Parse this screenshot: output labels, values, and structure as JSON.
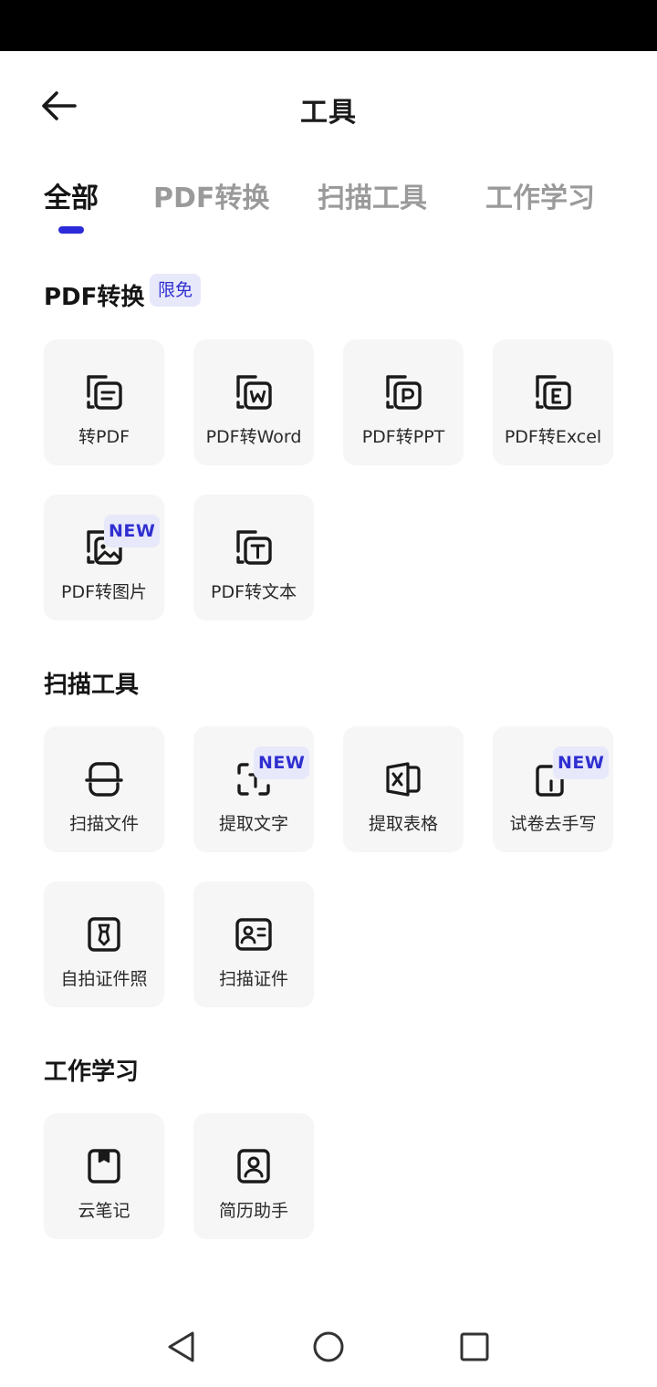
{
  "header": {
    "title": "工具",
    "back_icon": "arrow-left-icon"
  },
  "tabs": [
    {
      "label": "全部",
      "active": true
    },
    {
      "label": "PDF转换",
      "active": false
    },
    {
      "label": "扫描工具",
      "active": false
    },
    {
      "label": "工作学习",
      "active": false
    }
  ],
  "colors": {
    "accent": "#2b2bd9",
    "badge_bg": "#e8e8fb",
    "tile_bg": "#f6f6f6",
    "inactive_tab": "#9a9a9a"
  },
  "sections": [
    {
      "title": "PDF转换",
      "badge": "限免",
      "tools": [
        {
          "label": "转PDF",
          "icon": "convert-to-pdf-icon"
        },
        {
          "label": "PDF转Word",
          "icon": "pdf-to-word-icon"
        },
        {
          "label": "PDF转PPT",
          "icon": "pdf-to-ppt-icon"
        },
        {
          "label": "PDF转Excel",
          "icon": "pdf-to-excel-icon"
        },
        {
          "label": "PDF转图片",
          "icon": "pdf-to-image-icon",
          "badge": "NEW"
        },
        {
          "label": "PDF转文本",
          "icon": "pdf-to-text-icon"
        }
      ]
    },
    {
      "title": "扫描工具",
      "tools": [
        {
          "label": "扫描文件",
          "icon": "scan-document-icon"
        },
        {
          "label": "提取文字",
          "icon": "extract-text-icon",
          "badge": "NEW"
        },
        {
          "label": "提取表格",
          "icon": "extract-table-icon"
        },
        {
          "label": "试卷去手写",
          "icon": "remove-handwriting-icon",
          "badge": "NEW"
        },
        {
          "label": "自拍证件照",
          "icon": "id-photo-icon"
        },
        {
          "label": "扫描证件",
          "icon": "scan-id-card-icon"
        }
      ]
    },
    {
      "title": "工作学习",
      "tools": [
        {
          "label": "云笔记",
          "icon": "cloud-note-icon"
        },
        {
          "label": "简历助手",
          "icon": "resume-assistant-icon"
        }
      ]
    }
  ],
  "nav": {
    "back": "triangle-back-icon",
    "home": "circle-home-icon",
    "recents": "square-recents-icon"
  }
}
